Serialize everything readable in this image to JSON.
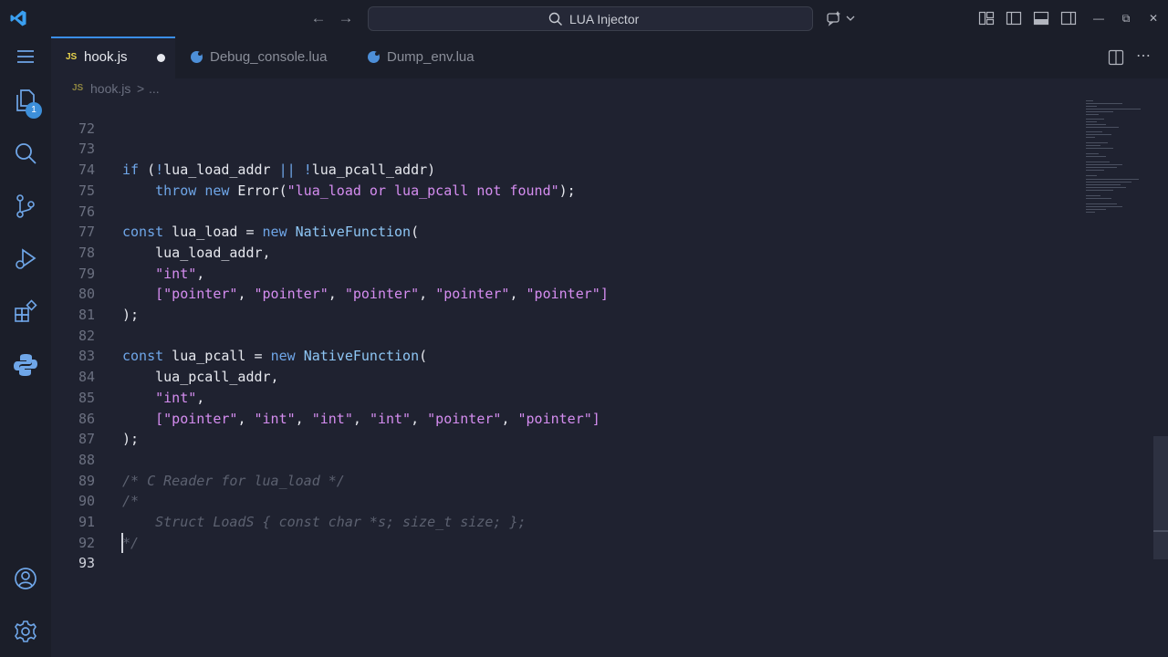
{
  "titlebar": {
    "search_label": "LUA Injector"
  },
  "activitybar": {
    "source_control_badge": "1"
  },
  "tabs": [
    {
      "label": "hook.js",
      "icon": "js-icon",
      "icon_text": "JS",
      "active": true,
      "modified": true
    },
    {
      "label": "Debug_console.lua",
      "icon": "lua-icon",
      "active": false
    },
    {
      "label": "Dump_env.lua",
      "icon": "lua-icon",
      "active": false
    }
  ],
  "breadcrumb": {
    "icon_text": "JS",
    "file": "hook.js",
    "separator": ">",
    "more": "..."
  },
  "editor": {
    "current_line": "93",
    "lines": [
      {
        "n": "72",
        "code": ""
      },
      {
        "n": "73",
        "code": "if (!lua_load_addr || !lua_pcall_addr)"
      },
      {
        "n": "74",
        "code": "    throw new Error(\"lua_load or lua_pcall not found\");"
      },
      {
        "n": "75",
        "code": ""
      },
      {
        "n": "76",
        "code": "const lua_load = new NativeFunction("
      },
      {
        "n": "77",
        "code": "    lua_load_addr,"
      },
      {
        "n": "78",
        "code": "    \"int\","
      },
      {
        "n": "79",
        "code": "    [\"pointer\", \"pointer\", \"pointer\", \"pointer\", \"pointer\"]"
      },
      {
        "n": "80",
        "code": ");"
      },
      {
        "n": "81",
        "code": ""
      },
      {
        "n": "82",
        "code": "const lua_pcall = new NativeFunction("
      },
      {
        "n": "83",
        "code": "    lua_pcall_addr,"
      },
      {
        "n": "84",
        "code": "    \"int\","
      },
      {
        "n": "85",
        "code": "    [\"pointer\", \"int\", \"int\", \"int\", \"pointer\", \"pointer\"]"
      },
      {
        "n": "86",
        "code": ");"
      },
      {
        "n": "87",
        "code": ""
      },
      {
        "n": "88",
        "code": "/* C Reader for lua_load */"
      },
      {
        "n": "89",
        "code": "/*"
      },
      {
        "n": "90",
        "code": "    Struct LoadS { const char *s; size_t size; };"
      },
      {
        "n": "91",
        "code": "*/"
      },
      {
        "n": "92",
        "code": ""
      },
      {
        "n": "93",
        "code": ""
      }
    ]
  },
  "colors": {
    "keyword": "#6fa6e8",
    "string": "#d58df0",
    "comment": "#5c6170",
    "accent": "#3a8ee6"
  }
}
